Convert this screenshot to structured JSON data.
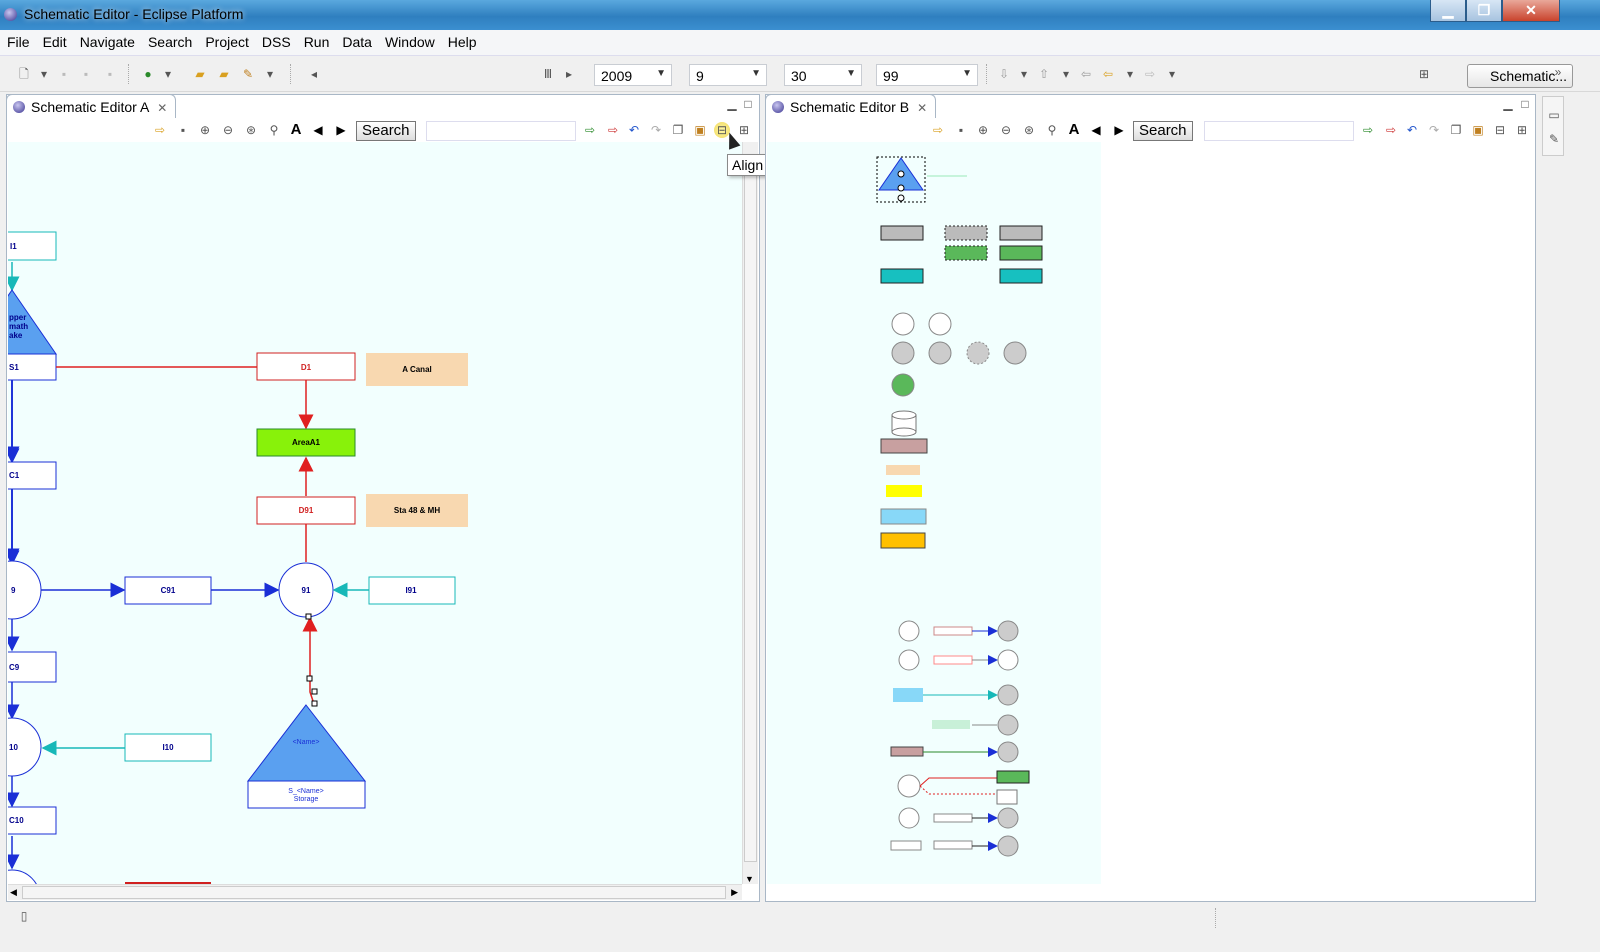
{
  "window": {
    "title": "Schematic Editor - Eclipse Platform"
  },
  "menu": [
    "File",
    "Edit",
    "Navigate",
    "Search",
    "Project",
    "DSS",
    "Run",
    "Data",
    "Window",
    "Help"
  ],
  "toolbar": {
    "year": "2009",
    "month": "9",
    "day": "30",
    "version": "99",
    "perspective": "Schematic..."
  },
  "editor_a": {
    "tab": "Schematic Editor A",
    "search_label": "Search",
    "tooltip": "Align Vertical",
    "nodes": {
      "i1": "I1",
      "upper_lake": [
        "pper",
        "math",
        "ake"
      ],
      "s1": "S1",
      "d1": "D1",
      "a_canal": "A Canal",
      "area_a1": "AreaA1",
      "d91": "D91",
      "sta": "Sta 48 & MH",
      "c1": "C1",
      "n9": "9",
      "c91": "C91",
      "n91": "91",
      "i91": "I91",
      "c9": "C9",
      "n10": "10",
      "i10": "I10",
      "c10": "C10",
      "storage_tri": "<Name>",
      "storage_label": [
        "S_<Name>",
        "Storage"
      ]
    }
  },
  "editor_b": {
    "tab": "Schematic Editor B",
    "search_label": "Search"
  }
}
